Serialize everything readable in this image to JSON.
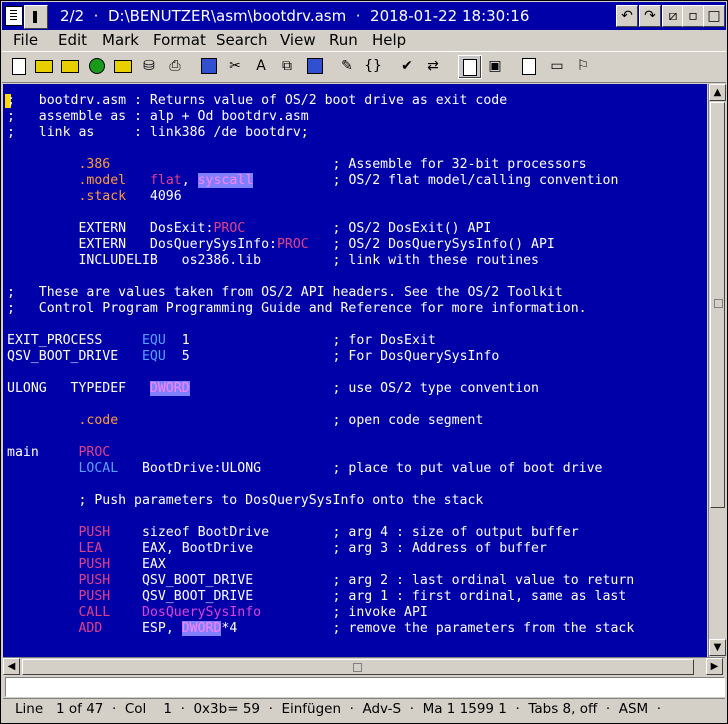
{
  "titlebar": {
    "title": "2/2  ·  D:\\BENUTZER\\asm\\bootdrv.asm  ·  2018-01-22 18:30:16"
  },
  "menu": [
    "File",
    "Edit",
    "Mark",
    "Format",
    "Search",
    "View",
    "Run",
    "Help"
  ],
  "toolbar": {
    "icons": [
      "new-file-icon",
      "open-file-icon",
      "open-folder-icon",
      "reload-icon",
      "folder-icon",
      "save-icon",
      "print-icon",
      "undo-icon",
      "cut-icon",
      "font-icon",
      "copy-icon",
      "abc-icon",
      "highlight-icon",
      "brackets-icon",
      "spellcheck-icon",
      "ifthen-icon",
      "window-icon",
      "new-window-icon",
      "document-icon",
      "command-icon",
      "run-icon"
    ]
  },
  "editor": {
    "language": "ASM",
    "lines": [
      ";   bootdrv.asm : Returns value of OS/2 boot drive as exit code",
      ";   assemble as : alp + Od bootdrv.asm",
      ";   link as     : link386 /de bootdrv;",
      "",
      "         .386                            ; Assemble for 32-bit processors",
      "         .model   flat, syscall          ; OS/2 flat model/calling convention",
      "         .stack   4096",
      "",
      "         EXTERN   DosExit:PROC           ; OS/2 DosExit() API",
      "         EXTERN   DosQuerySysInfo:PROC   ; OS/2 DosQuerySysInfo() API",
      "         INCLUDELIB   os2386.lib         ; link with these routines",
      "",
      ";   These are values taken from OS/2 API headers. See the OS/2 Toolkit",
      ";   Control Program Programming Guide and Reference for more information.",
      "",
      "EXIT_PROCESS     EQU  1                  ; for DosExit",
      "QSV_BOOT_DRIVE   EQU  5                  ; For DosQuerySysInfo",
      "",
      "ULONG   TYPEDEF   DWORD                  ; use OS/2 type convention",
      "",
      "         .code                           ; open code segment",
      "",
      "main     PROC",
      "         LOCAL   BootDrive:ULONG         ; place to put value of boot drive",
      "",
      "         ; Push parameters to DosQuerySysInfo onto the stack",
      "",
      "         PUSH    sizeof BootDrive        ; arg 4 : size of output buffer",
      "         LEA     EAX, BootDrive          ; arg 3 : Address of buffer",
      "         PUSH    EAX",
      "         PUSH    QSV_BOOT_DRIVE          ; arg 2 : last ordinal value to return",
      "         PUSH    QSV_BOOT_DRIVE          ; arg 1 : first ordinal, same as last",
      "         CALL    DosQuerySysInfo         ; invoke API",
      "         ADD     ESP, DWORD*4            ; remove the parameters from the stack"
    ]
  },
  "status": {
    "text": "Line   1 of 47  ·  Col    1  ·  0x3b= 59  ·  Einfügen  ·  Adv-S  ·  Ma 1 1599 1  ·  Tabs 8, off  ·  ASM  ·"
  },
  "colors": {
    "editor_bg": "#0000a8",
    "text": "#ffffff",
    "directive": "#ff9b3a",
    "keyword_red": "#e0408a",
    "keyword_magenta": "#e040d8",
    "keyword_blue": "#5aa0ff"
  }
}
